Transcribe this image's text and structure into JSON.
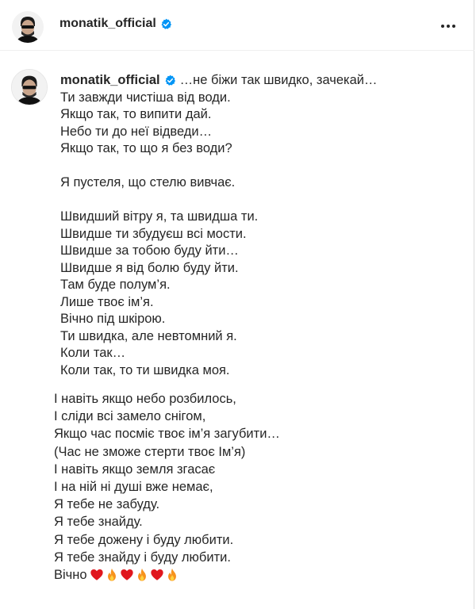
{
  "header": {
    "username": "monatik_official",
    "avatar": "avatar-icon",
    "more_icon": "more-options-icon"
  },
  "post": {
    "username": "monatik_official",
    "first_line": "…не біжи так швидко, зачекай…",
    "verse1": [
      "Ти завжди чистіша від води.",
      "Якщо так, то випити дай.",
      "Небо ти до неї відведи…",
      "Якщо так, то що я без води?"
    ],
    "verse2": [
      "Я пустеля, що стелю вивчає."
    ],
    "verse3": [
      "Швидший вітру я, та швидша ти.",
      "Швидше ти збудуєш всі мости.",
      "Швидше за тобою буду йти…",
      "Швидше я від болю буду йти.",
      "Там буде полум’я.",
      "Лише твоє ім’я.",
      "Вічно під шкірою.",
      "Ти швидка, але невтомний я.",
      "Коли так…",
      "Коли так, то ти швидка моя."
    ],
    "chorus": [
      "І навіть якщо небо розбилось,",
      "І сліди всі замело снігом,",
      "Якщо час посміє твоє ім’я загубити…",
      "(Час не зможе стерти твоє Ім’я)",
      "І навіть якщо земля згасає",
      "І на ній ні душі вже немає,",
      "Я тебе не забуду.",
      "Я тебе знайду.",
      "Я тебе дожену і буду любити.",
      "Я тебе знайду і буду любити."
    ],
    "last_word": "Вічно",
    "emoji_sequence": [
      "heart",
      "flame",
      "heart",
      "flame",
      "heart",
      "flame"
    ],
    "colors": {
      "verified": "#0095f6",
      "heart": "#e0161e",
      "flame": "#f7931e"
    }
  }
}
